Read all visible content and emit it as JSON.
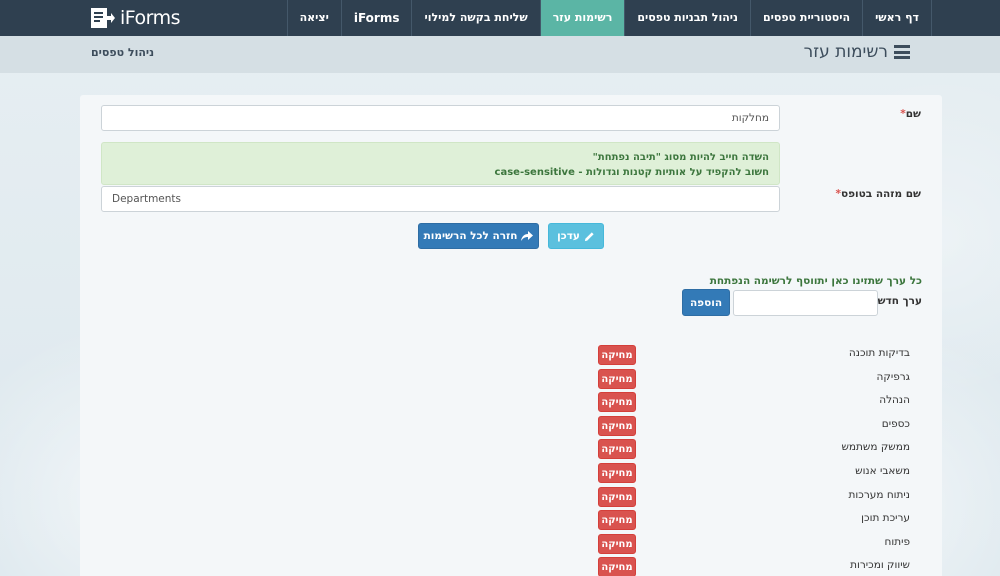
{
  "app": {
    "logo_text": "iForms"
  },
  "nav": {
    "items": [
      {
        "label": "דף ראשי",
        "active": false,
        "brand": false
      },
      {
        "label": "היסטוריית טפסים",
        "active": false,
        "brand": false
      },
      {
        "label": "ניהול תבניות טפסים",
        "active": false,
        "brand": false
      },
      {
        "label": "רשימות עזר",
        "active": true,
        "brand": false
      },
      {
        "label": "שליחת בקשה למילוי",
        "active": false,
        "brand": false
      },
      {
        "label": "iForms",
        "active": false,
        "brand": true
      },
      {
        "label": "יציאה",
        "active": false,
        "brand": false
      }
    ]
  },
  "header": {
    "title": "רשימות עזר",
    "breadcrumb": "ניהול טפסים"
  },
  "form": {
    "name_label": "שם",
    "name_value": "מחלקות",
    "alert_line1": "השדה חייב להיות מסוג \"תיבה נפתחת\"",
    "alert_line2": "חשוב להקפיד על אותיות קטנות וגדולות - case-sensitive",
    "field_id_label": "שם מזהה בטופס",
    "field_id_value": "Departments",
    "required_mark": "*",
    "edit_button": "עדכן",
    "back_button": "חזרה לכל הרשימות",
    "hint": "כל ערך שתזינו כאן יתווסף לרשימה הנפתחת",
    "new_value_label": "ערך חדש",
    "new_value_value": "",
    "add_button": "הוספה"
  },
  "list": {
    "delete_label": "מחיקה",
    "items": [
      "בדיקות תוכנה",
      "גרפיקה",
      "הנהלה",
      "כספים",
      "ממשק משתמש",
      "משאבי אנוש",
      "ניתוח מערכות",
      "עריכת תוכן",
      "פיתוח",
      "שיווק ומכירות"
    ]
  },
  "colors": {
    "nav_bg": "#2f4050",
    "nav_active": "#5bb5a5",
    "primary": "#337ab7",
    "info": "#5bc0de",
    "danger": "#d9534f",
    "success_text": "#3c763d"
  }
}
